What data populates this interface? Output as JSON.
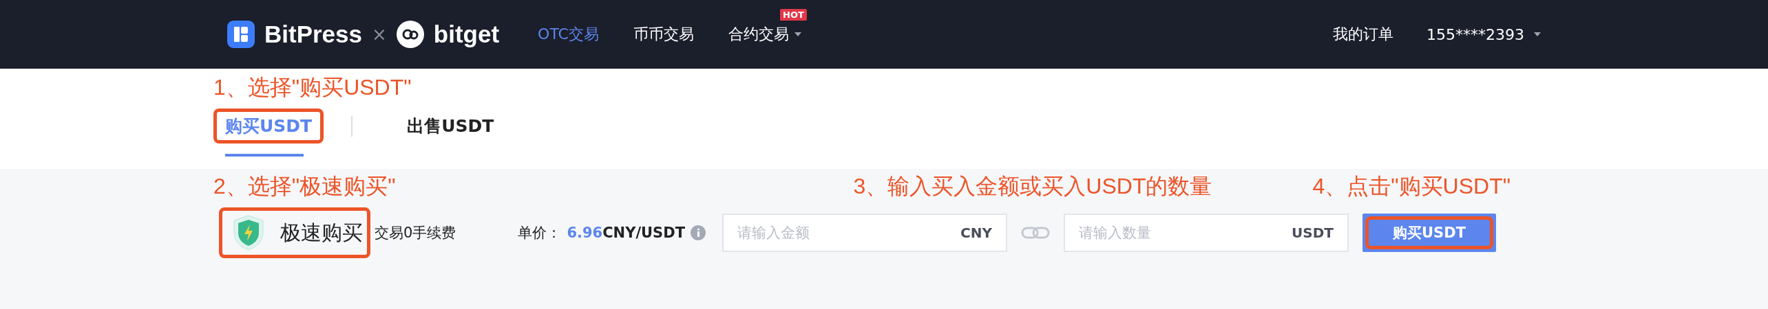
{
  "header": {
    "brand": "BitPress",
    "separator": "×",
    "partner": "bitget",
    "nav": [
      {
        "label": "OTC交易",
        "selected": true
      },
      {
        "label": "币币交易",
        "selected": false
      },
      {
        "label": "合约交易",
        "selected": false,
        "badge": "HOT",
        "dropdown": true
      }
    ],
    "orders": "我的订单",
    "account": "155****2393"
  },
  "step_1": "1、选择\"购买USDT\"",
  "tabs": [
    {
      "label": "购买USDT",
      "selected": true,
      "highlighted": true
    },
    {
      "label": "出售USDT",
      "selected": false,
      "highlighted": false
    }
  ],
  "step_2": "2、选择\"极速购买\"",
  "step_3": "3、输入买入金额或买入USDT的数量",
  "step_4": "4、点击\"购买USDT\"",
  "quick_buy": {
    "label": "极速购买",
    "highlighted": true,
    "note": "交易0手续费"
  },
  "price": {
    "label": "单价：",
    "value": "6.96",
    "unit": "CNY/USDT"
  },
  "amount_field": {
    "placeholder": "请输入金额",
    "unit": "CNY"
  },
  "quantity_field": {
    "placeholder": "请输入数量",
    "unit": "USDT"
  },
  "buy_button": {
    "label": "购买USDT",
    "highlighted": true
  }
}
